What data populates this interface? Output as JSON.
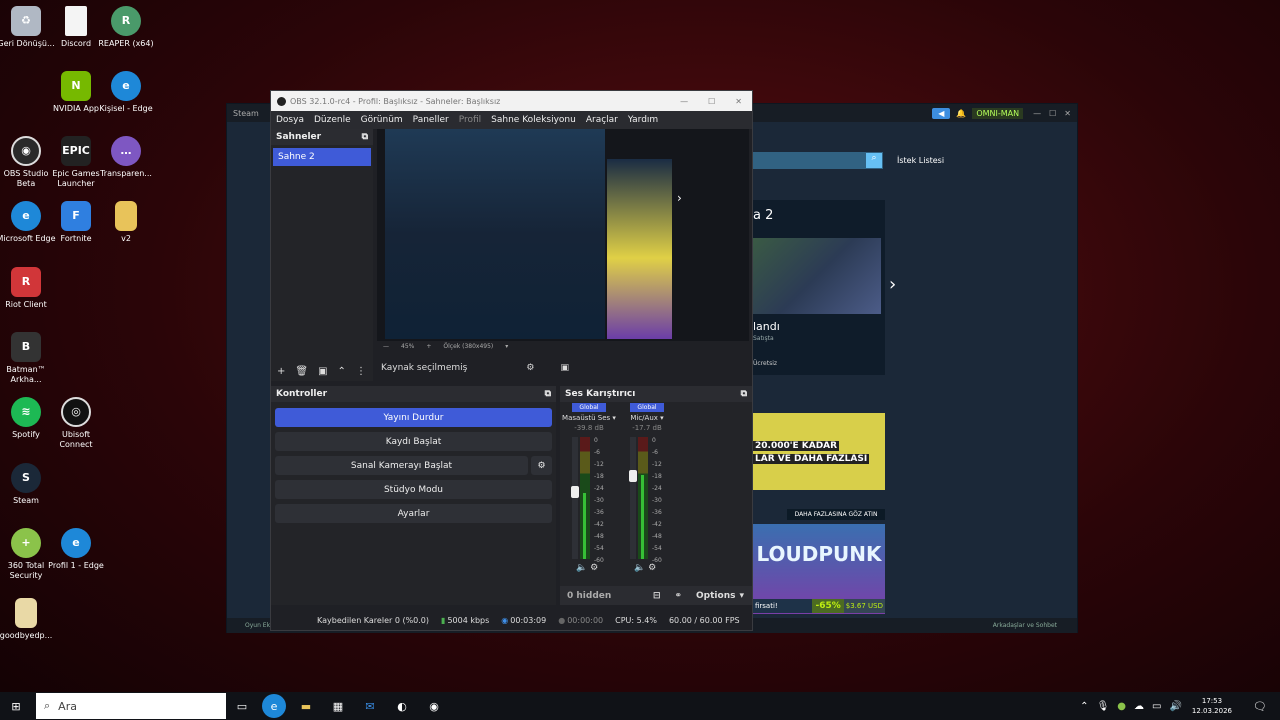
{
  "desktop": {
    "icons": [
      {
        "label": "Geri Dönüşü...",
        "icon": "recycle-bin-icon"
      },
      {
        "label": "Discord",
        "icon": "file-icon"
      },
      {
        "label": "REAPER (x64)",
        "icon": "reaper-icon"
      },
      {
        "label": "NVIDIA App",
        "icon": "nvidia-icon"
      },
      {
        "label": "Kişisel - Edge",
        "icon": "edge-icon"
      },
      {
        "label": "OBS Studio Beta",
        "icon": "obs-icon"
      },
      {
        "label": "Epic Games Launcher",
        "icon": "epic-icon"
      },
      {
        "label": "Transparen...",
        "icon": "chat-icon"
      },
      {
        "label": "Microsoft Edge",
        "icon": "edge-icon"
      },
      {
        "label": "Fortnite",
        "icon": "fortnite-icon"
      },
      {
        "label": "v2",
        "icon": "folder-icon"
      },
      {
        "label": "Riot Client",
        "icon": "riot-icon"
      },
      {
        "label": "Batman™ Arkha...",
        "icon": "batman-icon"
      },
      {
        "label": "Spotify",
        "icon": "spotify-icon"
      },
      {
        "label": "Ubisoft Connect",
        "icon": "ubisoft-icon"
      },
      {
        "label": "Steam",
        "icon": "steam-icon"
      },
      {
        "label": "360 Total Security",
        "icon": "shield-icon"
      },
      {
        "label": "Profil 1 - Edge",
        "icon": "edge-icon"
      },
      {
        "label": "goodbyedp...",
        "icon": "archive-icon"
      }
    ]
  },
  "steam": {
    "title": "Steam",
    "user": "OMNI-MAN",
    "wishlist": "İstek Listesi",
    "featured_title": "a 2",
    "featured_sub": "landı",
    "featured_tag": "Satışta",
    "featured_price": "Ücretsiz",
    "promo_text1": "20.000'E KADAR",
    "promo_text2": "LAR VE DAHA FAZLASI",
    "promo_banner": "DAHA FAZLASINA GÖZ ATIN",
    "game_title": "LOUDPUNK",
    "discount_label": "firsati!",
    "discount": "-65%",
    "price": "$3.67 USD",
    "status_left": "Oyun Ek",
    "status_right": "Arkadaşlar ve Sohbet"
  },
  "obs": {
    "title": "OBS 32.1.0-rc4 - Profil: Başlıksız - Sahneler: Başlıksız",
    "menu": [
      "Dosya",
      "Düzenle",
      "Görünüm",
      "Paneller",
      "Profil",
      "Sahne Koleksiyonu",
      "Araçlar",
      "Yardım"
    ],
    "scenes_header": "Sahneler",
    "scene_items": [
      "Sahne 2"
    ],
    "preview_zoom": "45%",
    "preview_res": "Ölçek (380x495)",
    "no_source": "Kaynak seçilmemiş",
    "controls_header": "Kontroller",
    "controls": {
      "stop_stream": "Yayını Durdur",
      "start_record": "Kaydı Başlat",
      "virtual_cam": "Sanal Kamerayı Başlat",
      "studio": "Stüdyo Modu",
      "settings": "Ayarlar"
    },
    "mixer_header": "Ses Karıştırıcı",
    "channels": [
      {
        "scope": "Global",
        "name": "Masaüstü Ses",
        "db": "-39.8 dB",
        "level": 0.55
      },
      {
        "scope": "Global",
        "name": "Mic/Aux",
        "db": "-17.7 dB",
        "level": 0.7
      }
    ],
    "ticks": [
      "0",
      "-6",
      "-12",
      "-18",
      "-24",
      "-30",
      "-36",
      "-42",
      "-48",
      "-54",
      "-60"
    ],
    "hidden": "0 hidden",
    "options": "Options",
    "status": {
      "dropped": "Kaybedilen Kareler 0 (%0.0)",
      "bitrate": "5004 kbps",
      "live_time": "00:03:09",
      "rec_time": "00:00:00",
      "cpu": "CPU: 5.4%",
      "fps": "60.00 / 60.00 FPS"
    }
  },
  "taskbar": {
    "search_placeholder": "Ara",
    "time": "17:53",
    "date": "12.03.2026"
  },
  "colors": {
    "accent": "#3f5bd8",
    "steam_bg": "#1b2838",
    "obs_bg": "#1f2025"
  }
}
